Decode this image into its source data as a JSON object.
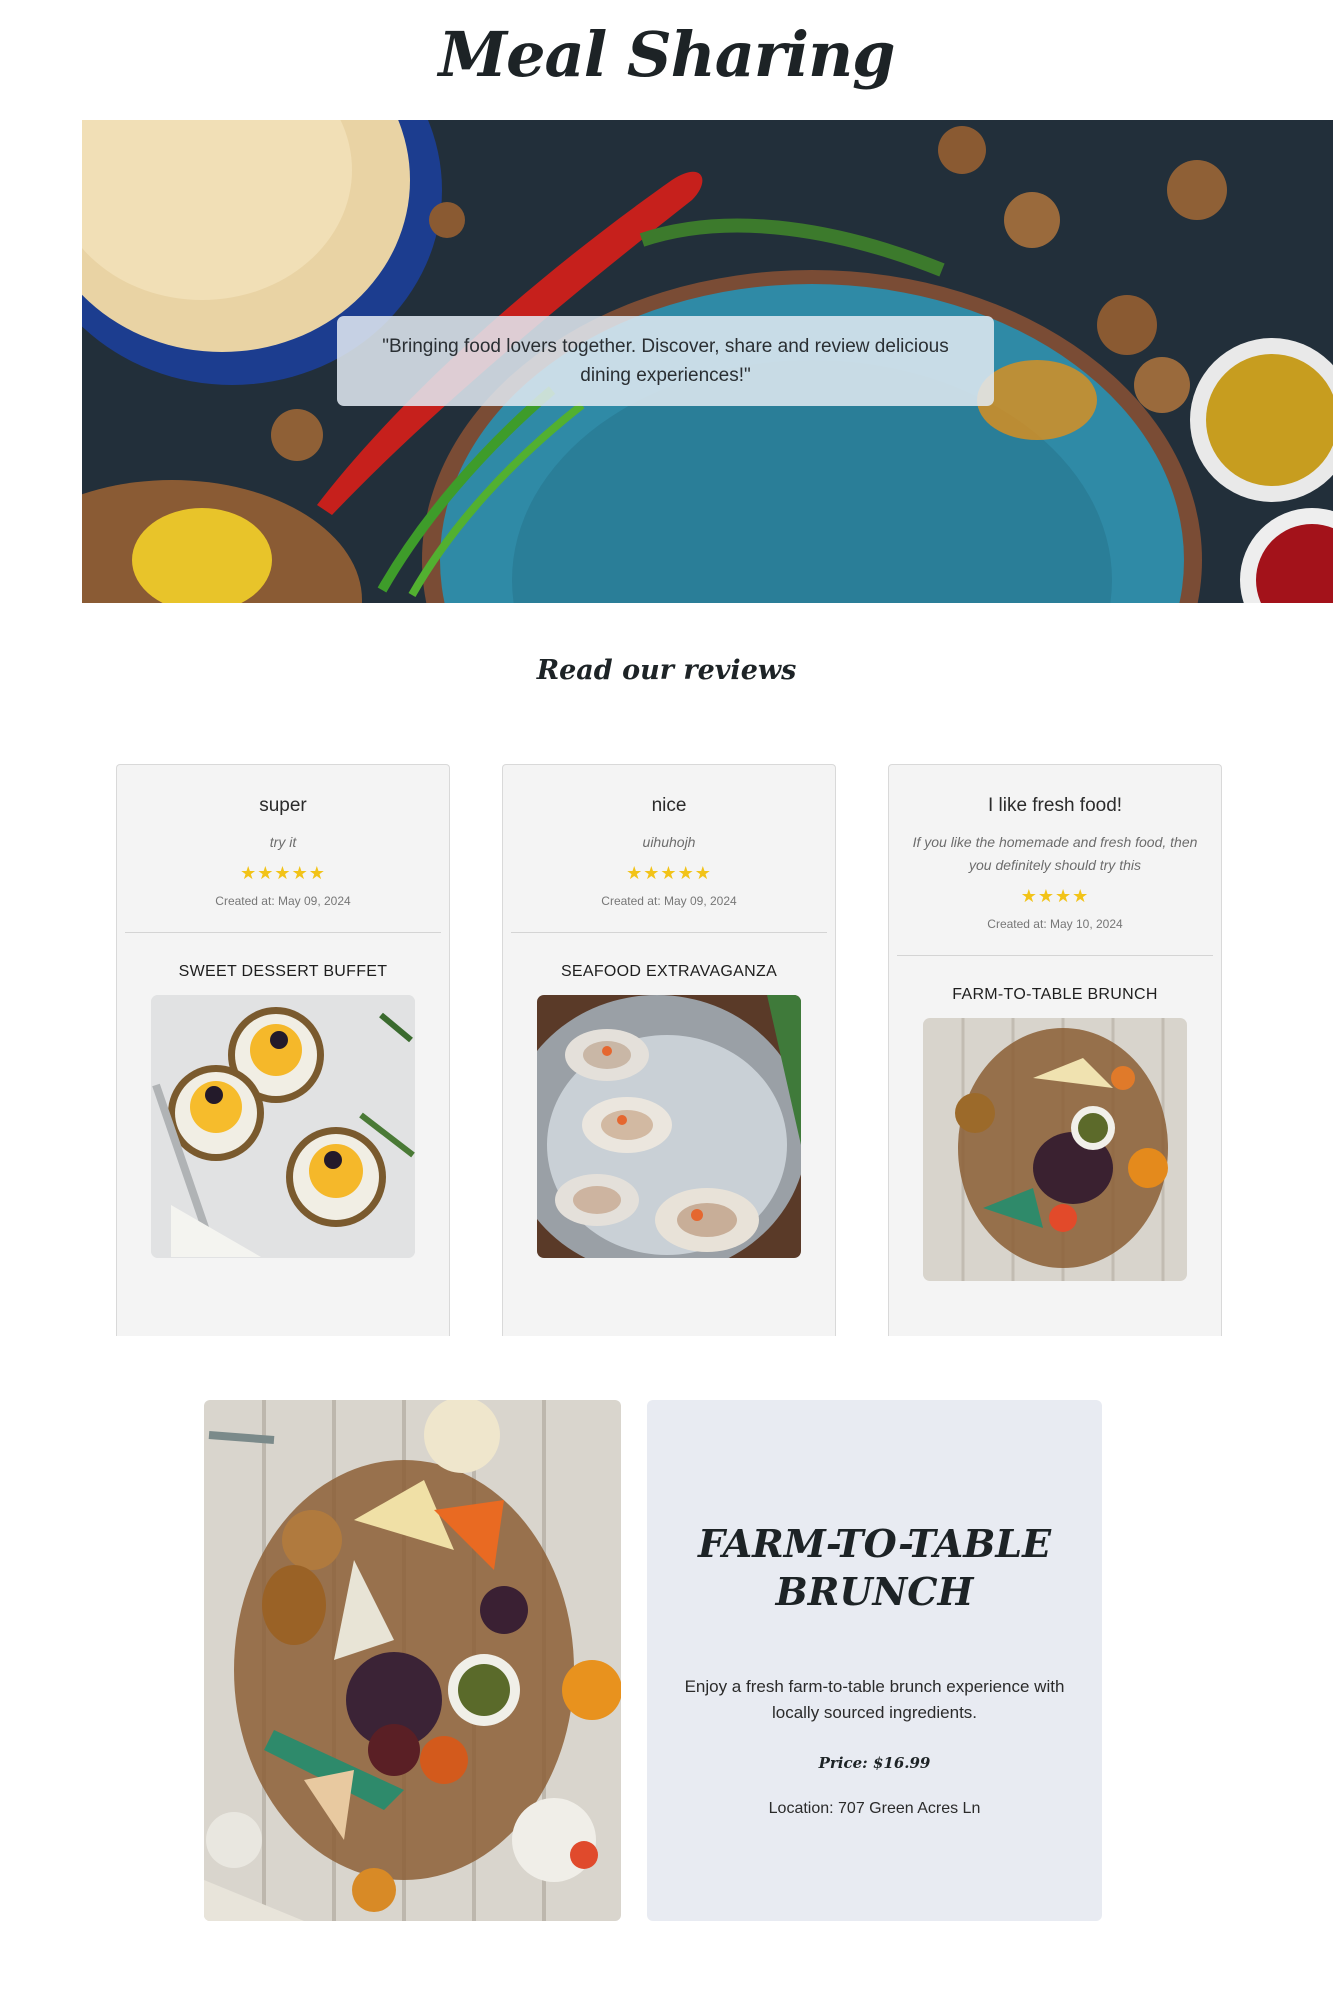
{
  "site": {
    "title": "Meal Sharing"
  },
  "hero": {
    "quote": "\"Bringing food lovers together. Discover, share and review delicious dining experiences!\""
  },
  "reviews_section": {
    "heading": "Read our reviews"
  },
  "reviews": [
    {
      "title": "super",
      "body": "try it",
      "stars": "★★★★★",
      "created": "Created at: May 09, 2024",
      "meal": "SWEET DESSERT BUFFET"
    },
    {
      "title": "nice",
      "body": "uihuhojh",
      "stars": "★★★★★",
      "created": "Created at: May 09, 2024",
      "meal": "SEAFOOD EXTRAVAGANZA"
    },
    {
      "title": "I like fresh food!",
      "body": "If you like the homemade and fresh food, then you definitely should try this",
      "stars": "★★★★",
      "created": "Created at: May 10, 2024",
      "meal": "FARM-TO-TABLE BRUNCH"
    }
  ],
  "featured_meal": {
    "title": "FARM-TO-TABLE BRUNCH",
    "description": "Enjoy a fresh farm-to-table brunch experience with locally sourced ingredients.",
    "price": "Price: $16.99",
    "location": "Location: 707 Green Acres Ln"
  },
  "colors": {
    "accent_star": "#f2c318",
    "card_bg": "#f4f4f4",
    "panel_bg": "#e8ebf2",
    "heading": "#1d2326"
  }
}
